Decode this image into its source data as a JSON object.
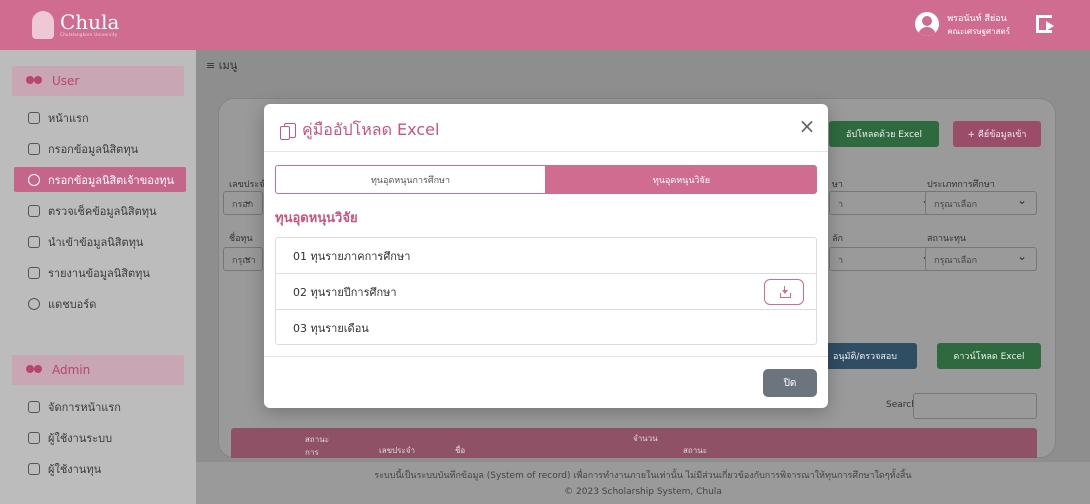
{
  "header": {
    "logo_text": "Chula",
    "logo_subtext": "Chulalongkorn University",
    "user_name": "พรอนันท์ สีย่อน",
    "user_faculty": "คณะเศรษฐศาสตร์"
  },
  "sidebar": {
    "user_section": "User",
    "user_items": [
      {
        "label": "หน้าแรก",
        "icon": "home-icon"
      },
      {
        "label": "กรอกข้อมูลนิสิตทุน",
        "icon": "user-icon"
      },
      {
        "label": "กรอกข้อมูลนิสิตเจ้าของทุน",
        "icon": "user-icon",
        "active": true
      },
      {
        "label": "ตรวจเช็คข้อมูลนิสิตทุน",
        "icon": "user-icon"
      },
      {
        "label": "นำเข้าข้อมูลนิสิตทุน",
        "icon": "user-icon"
      },
      {
        "label": "รายงานข้อมูลนิสิตทุน",
        "icon": "report-icon"
      },
      {
        "label": "แดชบอร์ด",
        "icon": "dashboard-icon"
      }
    ],
    "admin_section": "Admin",
    "admin_items": [
      {
        "label": "จัดการหน้าแรก",
        "icon": "home-icon"
      },
      {
        "label": "ผู้ใช้งานระบบ",
        "icon": "user-icon"
      },
      {
        "label": "ผู้ใช้งานทุน",
        "icon": "user-icon"
      }
    ]
  },
  "main": {
    "menu_label": "≡ เมนู",
    "upload_excel_label": "อัปโหลดด้วย Excel",
    "add_data_label": "+ คีย์ข้อมูลเข้า",
    "fields": [
      {
        "label": "เลขประจำ",
        "placeholder": "กรอก"
      },
      {
        "label": "ชื่อทุน",
        "placeholder": "กรุณา"
      },
      {
        "label": "ษา",
        "placeholder": "า"
      },
      {
        "label": "ประเภทการศึกษา",
        "placeholder": "กรุณาเลือก"
      },
      {
        "label": "ลัก",
        "placeholder": "า"
      },
      {
        "label": "สถานะทุน",
        "placeholder": "กรุณาเลือก"
      }
    ],
    "approve_label": "อนุมัติ/ตรวจสอบ",
    "download_excel_label": "ดาวน์โหลด Excel",
    "search_label": "Search:",
    "table_headers": [
      "สถานะ การ",
      "เลขประจำ",
      "ชื่อ",
      "จำนวน",
      "สถานะ"
    ]
  },
  "footer": {
    "line1": "ระบบนี้เป็นระบบบันทึกข้อมูล (System of record) เพื่อการทำงานภายในเท่านั้น ไม่มีส่วนเกี่ยวข้องกับการพิจารณาให้ทุนการศึกษาใดๆทั้งสิ้น",
    "line2": "© 2023 Scholarship System, Chula"
  },
  "modal": {
    "title": "คู่มืออัปโหลด Excel",
    "close_symbol": "×",
    "tabs": [
      {
        "label": "ทุนอุดหนุนการศึกษา",
        "active": false
      },
      {
        "label": "ทุนอุดหนุนวิจัย",
        "active": true
      }
    ],
    "section_title": "ทุนอุดหนุนวิจัย",
    "items": [
      {
        "label": "01 ทุนรายภาคการศึกษา",
        "download": false
      },
      {
        "label": "02 ทุนรายปีการศึกษา",
        "download": true
      },
      {
        "label": "03 ทุนรายเดือน",
        "download": false
      }
    ],
    "close_label": "ปิด"
  },
  "colors": {
    "brand_pink": "#d06c8f",
    "title_pink": "#c8557e",
    "close_gray": "#6c757d"
  }
}
